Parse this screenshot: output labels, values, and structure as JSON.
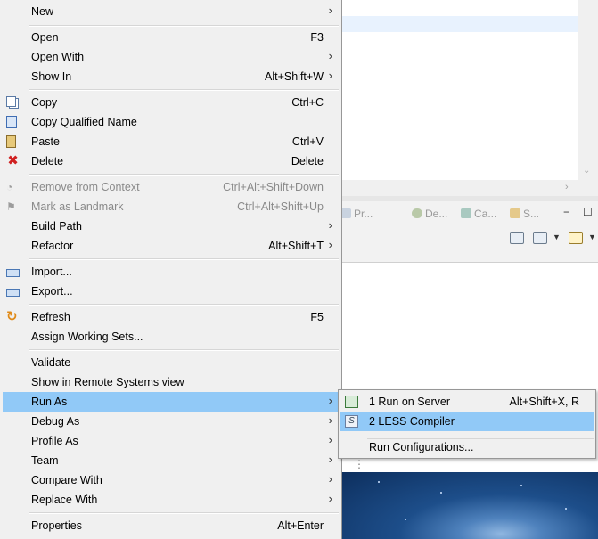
{
  "context_menu": {
    "items": [
      {
        "label": "New",
        "submenu": true
      },
      {
        "label": "Open",
        "shortcut": "F3"
      },
      {
        "label": "Open With",
        "submenu": true
      },
      {
        "label": "Show In",
        "shortcut": "Alt+Shift+W",
        "submenu": true
      },
      {
        "label": "Copy",
        "shortcut": "Ctrl+C",
        "icon": "copy-icon"
      },
      {
        "label": "Copy Qualified Name",
        "icon": "copy-qualified-name-icon"
      },
      {
        "label": "Paste",
        "shortcut": "Ctrl+V",
        "icon": "paste-icon"
      },
      {
        "label": "Delete",
        "shortcut": "Delete",
        "icon": "delete-icon"
      },
      {
        "label": "Remove from Context",
        "shortcut": "Ctrl+Alt+Shift+Down",
        "disabled": true,
        "icon": "remove-from-context-icon"
      },
      {
        "label": "Mark as Landmark",
        "shortcut": "Ctrl+Alt+Shift+Up",
        "disabled": true,
        "icon": "landmark-icon"
      },
      {
        "label": "Build Path",
        "submenu": true
      },
      {
        "label": "Refactor",
        "shortcut": "Alt+Shift+T",
        "submenu": true
      },
      {
        "label": "Import...",
        "icon": "import-icon"
      },
      {
        "label": "Export...",
        "icon": "export-icon"
      },
      {
        "label": "Refresh",
        "shortcut": "F5",
        "icon": "refresh-icon"
      },
      {
        "label": "Assign Working Sets..."
      },
      {
        "label": "Validate"
      },
      {
        "label": "Show in Remote Systems view"
      },
      {
        "label": "Run As",
        "submenu": true,
        "highlighted": true
      },
      {
        "label": "Debug As",
        "submenu": true
      },
      {
        "label": "Profile As",
        "submenu": true
      },
      {
        "label": "Team",
        "submenu": true
      },
      {
        "label": "Compare With",
        "submenu": true
      },
      {
        "label": "Replace With",
        "submenu": true
      },
      {
        "label": "Properties",
        "shortcut": "Alt+Enter"
      }
    ],
    "submenu_arrow": "›"
  },
  "run_as_submenu": {
    "items": [
      {
        "label": "1 Run on Server",
        "shortcut": "Alt+Shift+X, R",
        "icon": "run-on-server-icon"
      },
      {
        "label": "2 LESS Compiler",
        "icon": "less-compiler-icon",
        "highlighted": true
      },
      {
        "label": "Run Configurations..."
      }
    ]
  },
  "background": {
    "view_tabs": [
      "Pr...",
      "De...",
      "Ca...",
      "S..."
    ],
    "minimize_glyph": "−",
    "maximize_glyph": "☐",
    "more_glyph": "⋮"
  },
  "colors": {
    "menu_bg": "#f0f0f0",
    "highlight": "#91c9f7",
    "disabled_text": "#8a8a8a"
  }
}
